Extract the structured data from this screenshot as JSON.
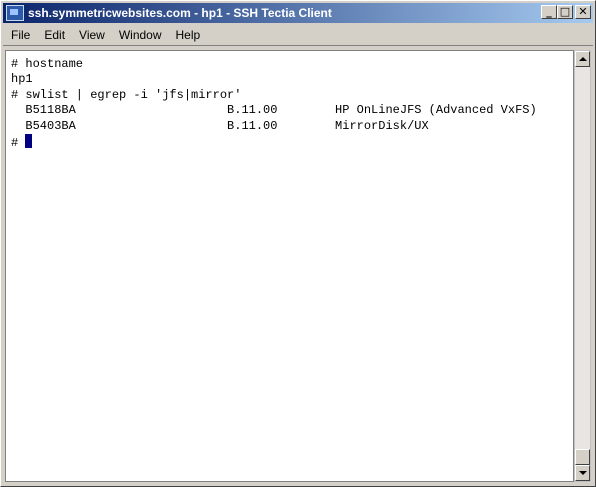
{
  "window": {
    "title": "ssh.symmetricwebsites.com - hp1 - SSH Tectia Client",
    "controls": {
      "minimize": "_",
      "maximize": "□",
      "close": "✕"
    }
  },
  "menu": {
    "items": [
      "File",
      "Edit",
      "View",
      "Window",
      "Help"
    ]
  },
  "terminal": {
    "lines": [
      "# hostname",
      "hp1",
      "# swlist | egrep -i 'jfs|mirror'",
      "  B5118BA                     B.11.00        HP OnLineJFS (Advanced VxFS)",
      "  B5403BA                     B.11.00        MirrorDisk/UX"
    ],
    "prompt": "# "
  }
}
